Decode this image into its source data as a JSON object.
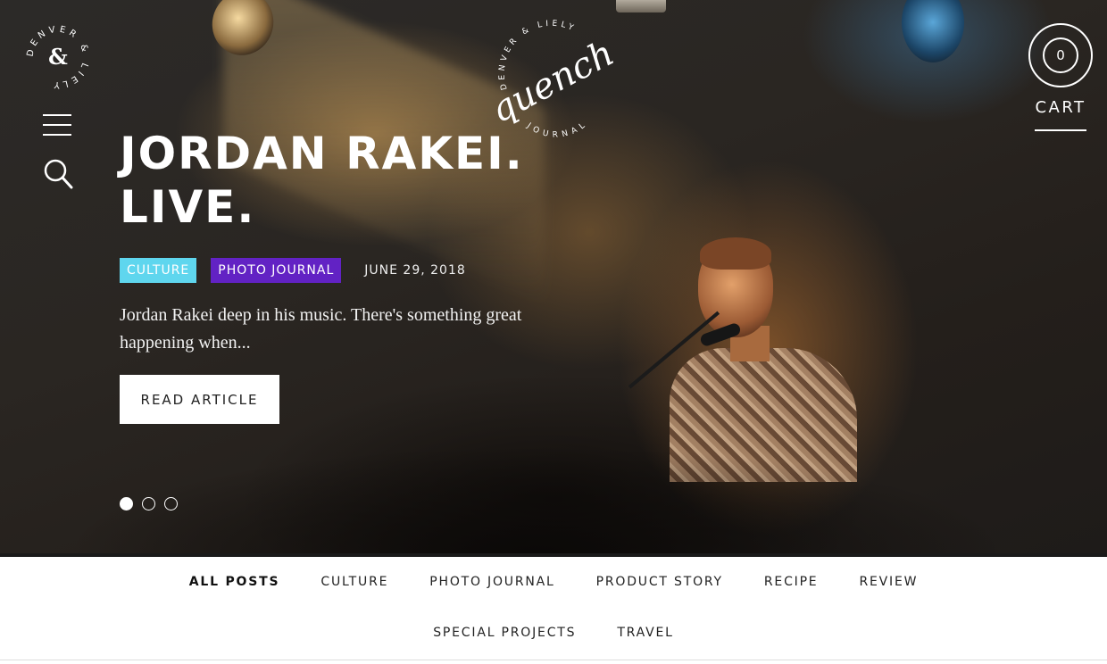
{
  "brand": {
    "badge_text": "DENVER & LIELY"
  },
  "journal_logo": {
    "script": "quench",
    "ring_top": "DENVER & LIELY",
    "ring_bottom": "JOURNAL"
  },
  "cart": {
    "count": "0",
    "label": "CART"
  },
  "hero": {
    "title_line1": "JORDAN RAKEI.",
    "title_line2": "LIVE.",
    "tags": [
      "CULTURE",
      "PHOTO JOURNAL"
    ],
    "date": "JUNE 29, 2018",
    "excerpt": "Jordan Rakei deep in his music. There's something great happening when...",
    "button_label": "READ ARTICLE",
    "slides": {
      "count": 3,
      "active": 1
    }
  },
  "colors": {
    "culture_tag": "#5fd6ee",
    "photo_tag": "#6222c4"
  },
  "categories": {
    "row1": [
      "ALL POSTS",
      "CULTURE",
      "PHOTO JOURNAL",
      "PRODUCT STORY",
      "RECIPE",
      "REVIEW"
    ],
    "row2": [
      "SPECIAL PROJECTS",
      "TRAVEL"
    ],
    "active": "ALL POSTS"
  },
  "icons": {
    "menu": "hamburger-icon",
    "search": "search-icon"
  }
}
